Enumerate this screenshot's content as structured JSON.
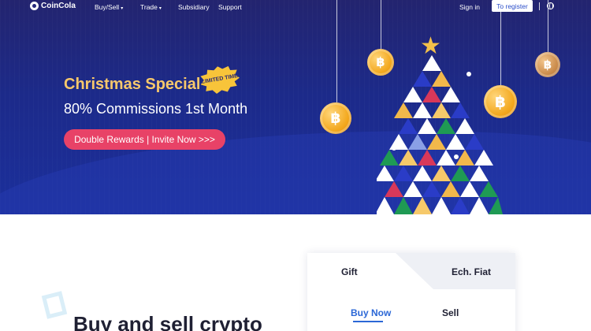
{
  "nav": {
    "logo_text": "CoinCola",
    "menu": [
      {
        "label": "Buy/Sell",
        "has_dropdown": true
      },
      {
        "label": "Trade",
        "has_dropdown": true
      },
      {
        "label": "Subsidiary",
        "has_dropdown": false
      },
      {
        "label": "Support",
        "has_dropdown": false
      }
    ],
    "caret": "▾",
    "sign_in": "Sign in",
    "register": "To register"
  },
  "hero": {
    "promo_title": "Christmas Special",
    "badge": "LIMITED TIME",
    "promo_subtitle": "80% Commissions 1st Month",
    "cta": "Double Rewards  |  Invite Now  >>>",
    "coin_symbol": "฿"
  },
  "main": {
    "heading": "Buy and sell crypto"
  },
  "trade_card": {
    "tabs": [
      "Gift",
      "Ech. Fiat"
    ],
    "sub_tabs": [
      "Buy Now",
      "Sell"
    ],
    "active_tab": "Gift",
    "active_sub_tab": "Buy Now"
  },
  "colors": {
    "hero_bg": "#1c2a8a",
    "accent_gold": "#f8c86b",
    "cta_pink": "#e84267",
    "link_blue": "#2b67d6"
  }
}
